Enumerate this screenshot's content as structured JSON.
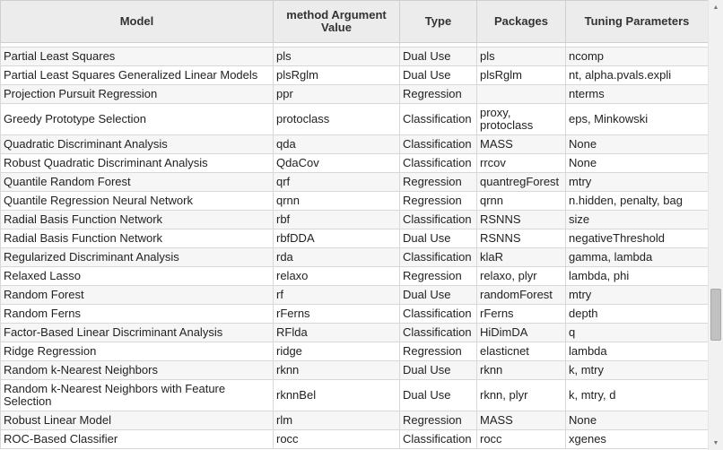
{
  "columns": [
    "Model",
    "method Argument Value",
    "Type",
    "Packages",
    "Tuning Parameters"
  ],
  "rows": [
    [
      "Partial Least Squares",
      "pls",
      "Dual Use",
      "pls",
      "ncomp"
    ],
    [
      "Partial Least Squares Generalized Linear Models",
      "plsRglm",
      "Dual Use",
      "plsRglm",
      "nt, alpha.pvals.expli"
    ],
    [
      "Projection Pursuit Regression",
      "ppr",
      "Regression",
      "",
      "nterms"
    ],
    [
      "Greedy Prototype Selection",
      "protoclass",
      "Classification",
      "proxy, protoclass",
      "eps, Minkowski"
    ],
    [
      "Quadratic Discriminant Analysis",
      "qda",
      "Classification",
      "MASS",
      "None"
    ],
    [
      "Robust Quadratic Discriminant Analysis",
      "QdaCov",
      "Classification",
      "rrcov",
      "None"
    ],
    [
      "Quantile Random Forest",
      "qrf",
      "Regression",
      "quantregForest",
      "mtry"
    ],
    [
      "Quantile Regression Neural Network",
      "qrnn",
      "Regression",
      "qrnn",
      "n.hidden, penalty, bag"
    ],
    [
      "Radial Basis Function Network",
      "rbf",
      "Classification",
      "RSNNS",
      "size"
    ],
    [
      "Radial Basis Function Network",
      "rbfDDA",
      "Dual Use",
      "RSNNS",
      "negativeThreshold"
    ],
    [
      "Regularized Discriminant Analysis",
      "rda",
      "Classification",
      "klaR",
      "gamma, lambda"
    ],
    [
      "Relaxed Lasso",
      "relaxo",
      "Regression",
      "relaxo, plyr",
      "lambda, phi"
    ],
    [
      "Random Forest",
      "rf",
      "Dual Use",
      "randomForest",
      "mtry"
    ],
    [
      "Random Ferns",
      "rFerns",
      "Classification",
      "rFerns",
      "depth"
    ],
    [
      "Factor-Based Linear Discriminant Analysis",
      "RFlda",
      "Classification",
      "HiDimDA",
      "q"
    ],
    [
      "Ridge Regression",
      "ridge",
      "Regression",
      "elasticnet",
      "lambda"
    ],
    [
      "Random k-Nearest Neighbors",
      "rknn",
      "Dual Use",
      "rknn",
      "k, mtry"
    ],
    [
      "Random k-Nearest Neighbors with Feature Selection",
      "rknnBel",
      "Dual Use",
      "rknn, plyr",
      "k, mtry, d"
    ],
    [
      "Robust Linear Model",
      "rlm",
      "Regression",
      "MASS",
      "None"
    ],
    [
      "ROC-Based Classifier",
      "rocc",
      "Classification",
      "rocc",
      "xgenes"
    ]
  ],
  "tall_rows": [
    3,
    17
  ],
  "scrollbar": {
    "up_arrow": "up-arrow-icon",
    "down_arrow": "down-arrow-icon"
  }
}
